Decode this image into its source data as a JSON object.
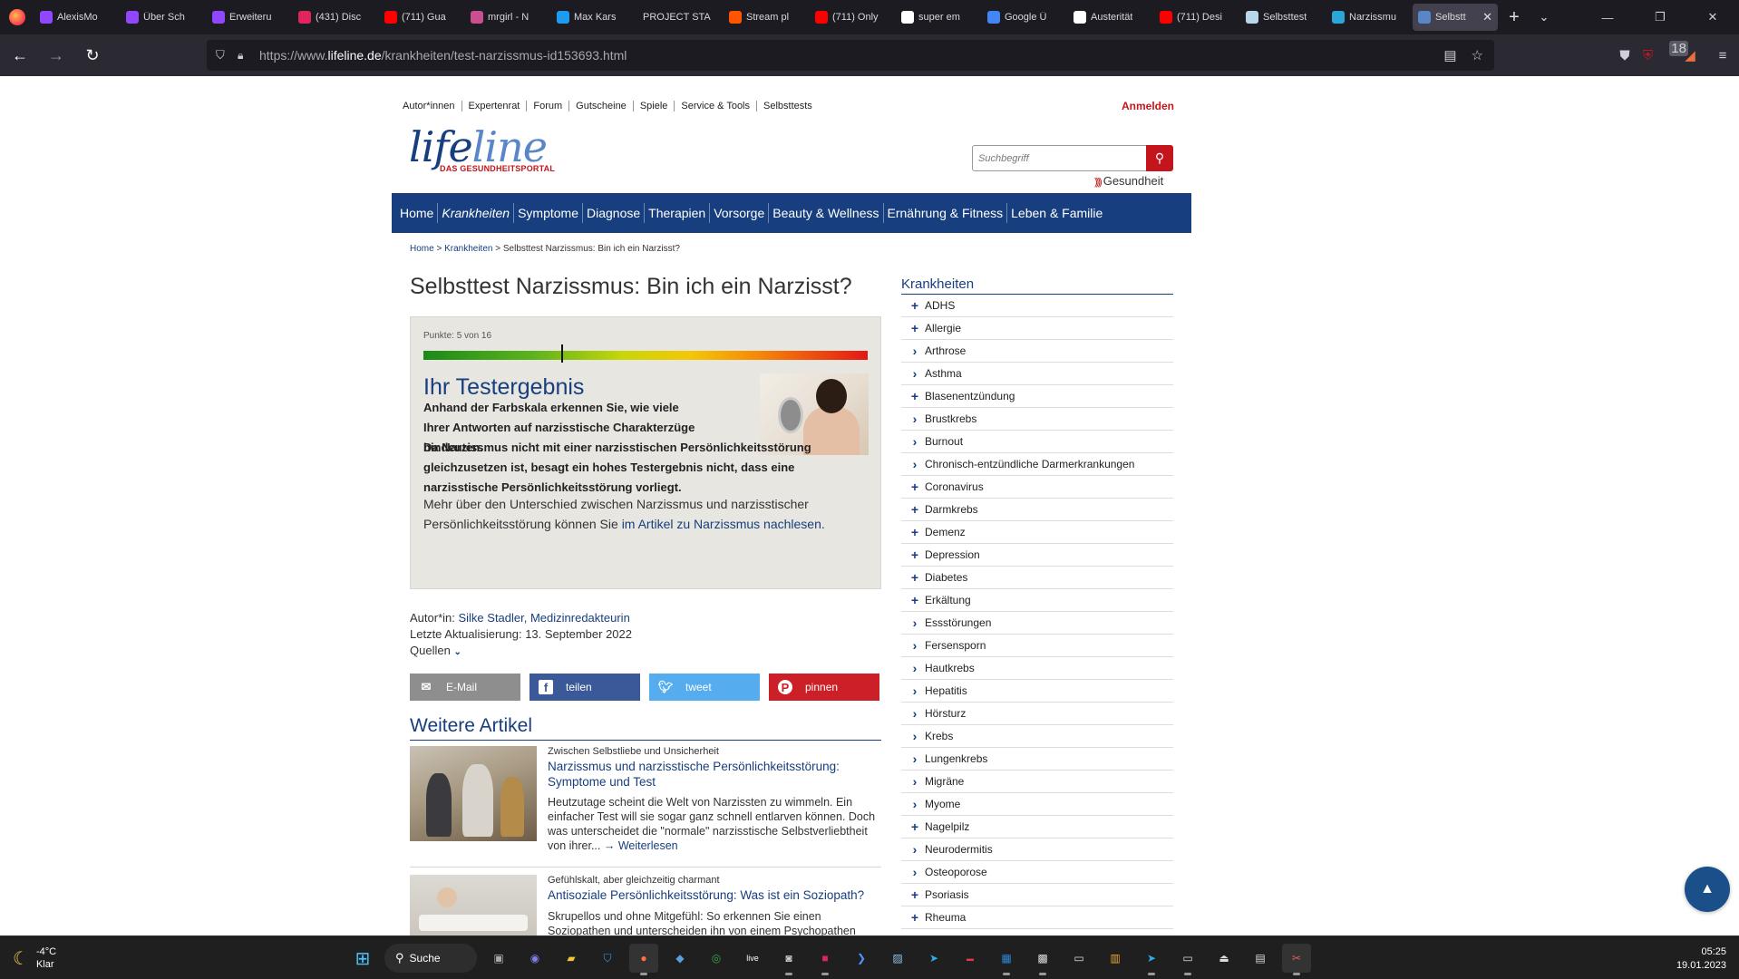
{
  "browser": {
    "tabs": [
      {
        "label": "AlexisMo",
        "icon": "twitch-icon",
        "color": "#9146ff"
      },
      {
        "label": "Über Sch",
        "icon": "twitch-icon",
        "color": "#9146ff"
      },
      {
        "label": "Erweiteru",
        "icon": "twitch-icon",
        "color": "#9146ff"
      },
      {
        "label": "(431) Disc",
        "icon": "discord-icon",
        "color": "#e0245e"
      },
      {
        "label": "(711) Gua",
        "icon": "youtube-icon",
        "color": "#ff0000"
      },
      {
        "label": "mrgirl - N",
        "icon": "heart-icon",
        "color": "#c94f8e"
      },
      {
        "label": "Max Kars",
        "icon": "twitter-icon",
        "color": "#1d9bf0"
      },
      {
        "label": "PROJECT STA",
        "icon": "",
        "color": ""
      },
      {
        "label": "Stream pl",
        "icon": "soundcloud-icon",
        "color": "#ff5500"
      },
      {
        "label": "(711) Only",
        "icon": "youtube-icon",
        "color": "#ff0000"
      },
      {
        "label": "super em",
        "icon": "google-icon",
        "color": "#ffffff"
      },
      {
        "label": "Google Ü",
        "icon": "google-translate-icon",
        "color": "#4285f4"
      },
      {
        "label": "Austerität",
        "icon": "wikipedia-icon",
        "color": "#ffffff"
      },
      {
        "label": "(711) Desi",
        "icon": "youtube-icon",
        "color": "#ff0000"
      },
      {
        "label": "Selbsttest",
        "icon": "page-icon",
        "color": "#b9d7ea"
      },
      {
        "label": "Narzissmu",
        "icon": "edge-icon",
        "color": "#2aa7d8"
      },
      {
        "label": "Selbstt",
        "icon": "lifeline-icon",
        "color": "#5a86c8",
        "active": true
      }
    ],
    "url_prefix": "https://www.",
    "url_host": "lifeline.de",
    "url_path": "/krankheiten/test-narzissmus-id153693.html",
    "badge_count": "18"
  },
  "site": {
    "topnav": [
      "Autor*innen",
      "Expertenrat",
      "Forum",
      "Gutscheine",
      "Spiele",
      "Service & Tools",
      "Selbsttests"
    ],
    "login": "Anmelden",
    "logo_word_a": "life",
    "logo_word_b": "line",
    "logo_tagline": "DAS GESUNDHEITSPORTAL",
    "search_placeholder": "Suchbegriff",
    "partner": "Gesundheit",
    "mainnav": [
      "Home",
      "Krankheiten",
      "Symptome",
      "Diagnose",
      "Therapien",
      "Vorsorge",
      "Beauty & Wellness",
      "Ernährung & Fitness",
      "Leben & Familie"
    ],
    "mainnav_current": "Krankheiten"
  },
  "breadcrumb": {
    "home": "Home",
    "sep1": " > ",
    "section": "Krankheiten",
    "sep2": " > ",
    "current": "Selbsttest Narzissmus: Bin ich ein Narzisst?"
  },
  "article": {
    "title": "Selbsttest Narzissmus: Bin ich ein Narzisst?",
    "score_label": "Punkte: 5 von 16",
    "score": 5,
    "score_max": 16,
    "result_heading": "Ihr Testergebnis",
    "para1": "Anhand der Farbskala erkennen Sie, wie viele Ihrer Antworten auf narzisstische Charakterzüge hindeuten.",
    "para2": "Da Narzissmus nicht mit einer narzisstischen Persönlichkeitsstörung gleichzusetzen ist, besagt ein hohes Testergebnis nicht, dass eine narzisstische Persönlichkeitsstörung vorliegt.",
    "para3_text": "Mehr über den Unterschied zwischen Narzissmus und narzisstischer Persönlichkeitsstörung können Sie ",
    "para3_link": "im Artikel zu Narzissmus nachlesen.",
    "author_label": "Autor*in: ",
    "author": "Silke Stadler, Medizinredakteurin",
    "updated": "Letzte Aktualisierung: 13. September 2022",
    "sources": "Quellen"
  },
  "share": {
    "mail": "E-Mail",
    "facebook": "teilen",
    "twitter": "tweet",
    "pinterest": "pinnen"
  },
  "related": {
    "heading": "Weitere Artikel",
    "items": [
      {
        "kicker": "Zwischen Selbstliebe und Unsicherheit",
        "title": "Narzissmus und narzisstische Persönlichkeitsstörung: Symptome und Test",
        "teaser": "Heutzutage scheint die Welt von Narzissten zu wimmeln. Ein einfacher Test will sie sogar ganz schnell entlarven können. Doch was unterscheidet die \"normale\" narzisstische Selbstverliebtheit von ihrer...",
        "more": "→ Weiterlesen"
      },
      {
        "kicker": "Gefühlskalt, aber gleichzeitig charmant",
        "title": "Antisoziale Persönlichkeitsstörung: Was ist ein Soziopath?",
        "teaser": "Skrupellos und ohne Mitgefühl: So erkennen Sie einen Soziopathen und unterscheiden ihn von einem Psychopathen"
      }
    ]
  },
  "sidebar": {
    "title": "Krankheiten",
    "items": [
      {
        "label": "ADHS",
        "icon": "+"
      },
      {
        "label": "Allergie",
        "icon": "+"
      },
      {
        "label": "Arthrose",
        "icon": "›"
      },
      {
        "label": "Asthma",
        "icon": "›"
      },
      {
        "label": "Blasenentzündung",
        "icon": "+"
      },
      {
        "label": "Brustkrebs",
        "icon": "›"
      },
      {
        "label": "Burnout",
        "icon": "›"
      },
      {
        "label": "Chronisch-entzündliche Darmerkrankungen",
        "icon": "›"
      },
      {
        "label": "Coronavirus",
        "icon": "+"
      },
      {
        "label": "Darmkrebs",
        "icon": "+"
      },
      {
        "label": "Demenz",
        "icon": "+"
      },
      {
        "label": "Depression",
        "icon": "+"
      },
      {
        "label": "Diabetes",
        "icon": "+"
      },
      {
        "label": "Erkältung",
        "icon": "+"
      },
      {
        "label": "Essstörungen",
        "icon": "›"
      },
      {
        "label": "Fersensporn",
        "icon": "›"
      },
      {
        "label": "Hautkrebs",
        "icon": "›"
      },
      {
        "label": "Hepatitis",
        "icon": "›"
      },
      {
        "label": "Hörsturz",
        "icon": "›"
      },
      {
        "label": "Krebs",
        "icon": "›"
      },
      {
        "label": "Lungenkrebs",
        "icon": "›"
      },
      {
        "label": "Migräne",
        "icon": "›"
      },
      {
        "label": "Myome",
        "icon": "›"
      },
      {
        "label": "Nagelpilz",
        "icon": "+"
      },
      {
        "label": "Neurodermitis",
        "icon": "›"
      },
      {
        "label": "Osteoporose",
        "icon": "›"
      },
      {
        "label": "Psoriasis",
        "icon": "+"
      },
      {
        "label": "Rheuma",
        "icon": "+"
      }
    ]
  },
  "taskbar": {
    "temp": "-4°C",
    "weather": "Klar",
    "search": "Suche",
    "time": "05:25",
    "date": "19.01.2023"
  }
}
